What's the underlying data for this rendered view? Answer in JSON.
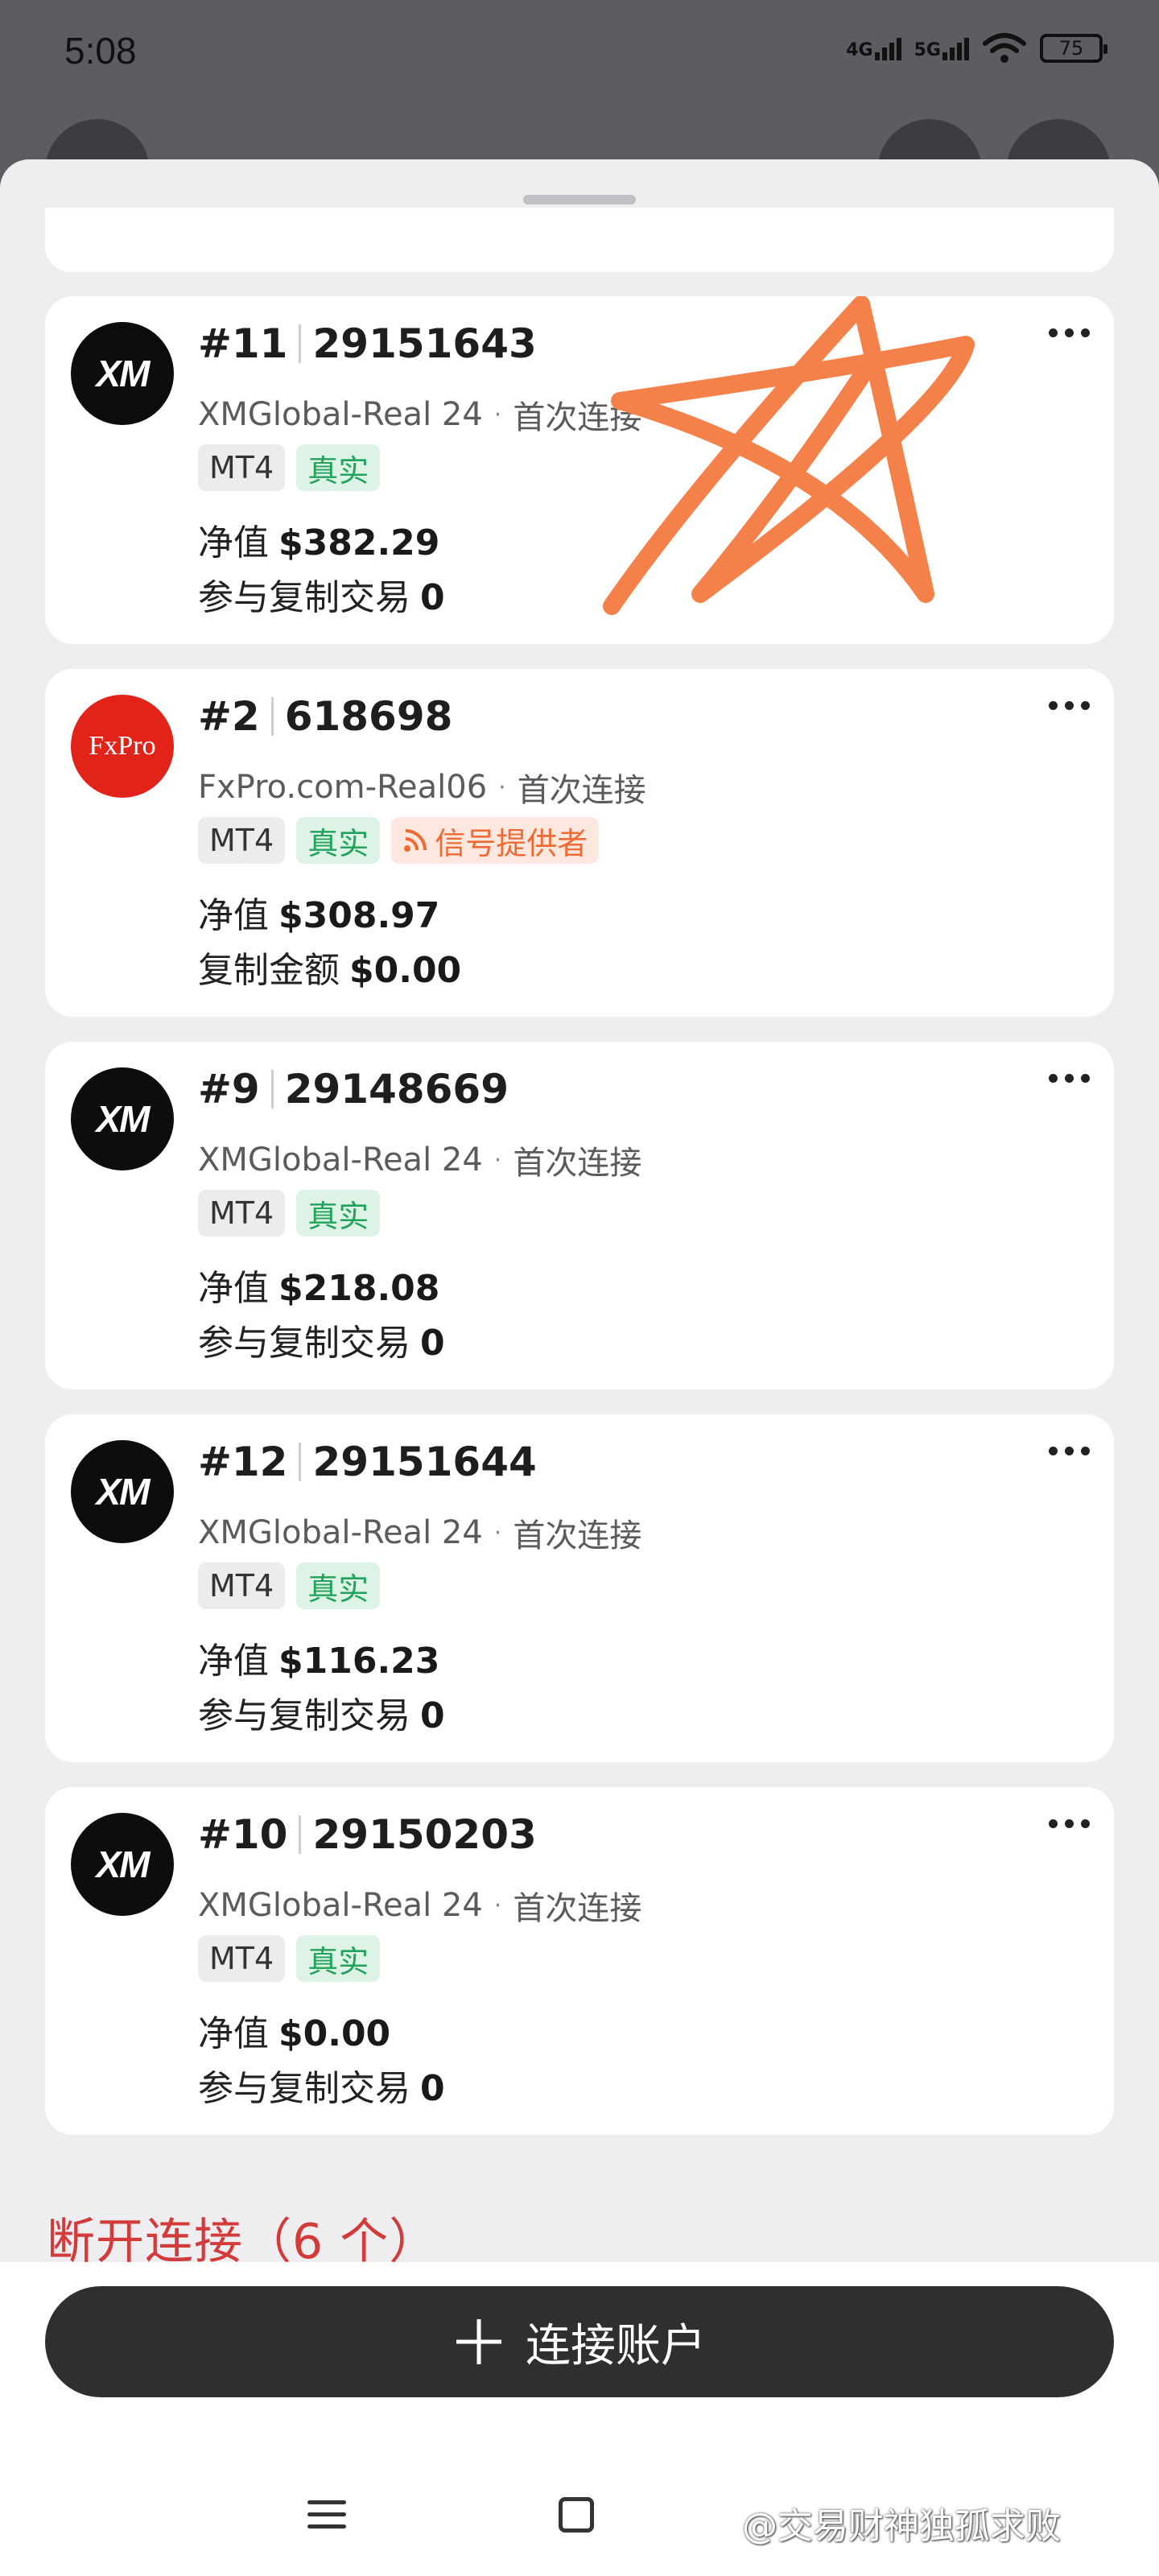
{
  "status_bar": {
    "time": "5:08",
    "net1": "4G",
    "net2": "5G",
    "battery": "75"
  },
  "accounts": [
    {
      "number": "#11",
      "id": "29151643",
      "logo_text": "XM",
      "logo_type": "xm",
      "server": "XMGlobal-Real 24",
      "status": "首次连接",
      "platform_tag": "MT4",
      "real_tag": "真实",
      "signal_tag": "",
      "equity_label": "净值",
      "equity_value": "$382.29",
      "second_label": "参与复制交易",
      "second_value": "0"
    },
    {
      "number": "#2",
      "id": "618698",
      "logo_text": "FxPro",
      "logo_type": "fx",
      "server": "FxPro.com-Real06",
      "status": "首次连接",
      "platform_tag": "MT4",
      "real_tag": "真实",
      "signal_tag": "信号提供者",
      "equity_label": "净值",
      "equity_value": "$308.97",
      "second_label": "复制金额",
      "second_value": "$0.00"
    },
    {
      "number": "#9",
      "id": "29148669",
      "logo_text": "XM",
      "logo_type": "xm",
      "server": "XMGlobal-Real 24",
      "status": "首次连接",
      "platform_tag": "MT4",
      "real_tag": "真实",
      "signal_tag": "",
      "equity_label": "净值",
      "equity_value": "$218.08",
      "second_label": "参与复制交易",
      "second_value": "0"
    },
    {
      "number": "#12",
      "id": "29151644",
      "logo_text": "XM",
      "logo_type": "xm",
      "server": "XMGlobal-Real 24",
      "status": "首次连接",
      "platform_tag": "MT4",
      "real_tag": "真实",
      "signal_tag": "",
      "equity_label": "净值",
      "equity_value": "$116.23",
      "second_label": "参与复制交易",
      "second_value": "0"
    },
    {
      "number": "#10",
      "id": "29150203",
      "logo_text": "XM",
      "logo_type": "xm",
      "server": "XMGlobal-Real 24",
      "status": "首次连接",
      "platform_tag": "MT4",
      "real_tag": "真实",
      "signal_tag": "",
      "equity_label": "净值",
      "equity_value": "$0.00",
      "second_label": "参与复制交易",
      "second_value": "0"
    }
  ],
  "disconnected_heading": "断开连接（6 个）",
  "connect_button": {
    "icon": "plus-icon",
    "label": "连接账户"
  },
  "watermark": "@交易财神独孤求败",
  "colors": {
    "accent_red": "#d33a3a",
    "real_green": "#21a35b",
    "signal_orange": "#f06a35",
    "scribble": "#f5814a"
  }
}
